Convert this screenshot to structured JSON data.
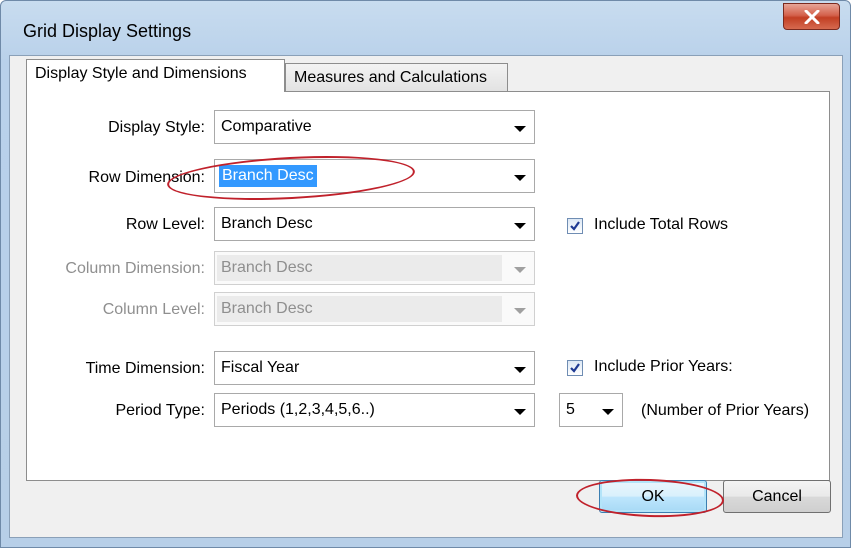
{
  "window": {
    "title": "Grid Display Settings",
    "close_icon": "close-icon"
  },
  "tabs": [
    {
      "label": "Display Style and Dimensions",
      "active": true
    },
    {
      "label": "Measures and Calculations",
      "active": false
    }
  ],
  "form": {
    "display_style": {
      "label": "Display Style:",
      "value": "Comparative"
    },
    "row_dimension": {
      "label": "Row Dimension:",
      "value": "Branch Desc"
    },
    "row_level": {
      "label": "Row Level:",
      "value": "Branch Desc"
    },
    "column_dimension": {
      "label": "Column Dimension:",
      "value": "Branch Desc"
    },
    "column_level": {
      "label": "Column Level:",
      "value": "Branch Desc"
    },
    "time_dimension": {
      "label": "Time Dimension:",
      "value": "Fiscal Year"
    },
    "period_type": {
      "label": "Period Type:",
      "value": "Periods (1,2,3,4,5,6..)"
    },
    "prior_years_count": {
      "value": "5",
      "note": "(Number of Prior Years)"
    }
  },
  "checkboxes": {
    "include_total_rows": {
      "label": "Include Total Rows",
      "checked": true
    },
    "include_prior_years": {
      "label": "Include Prior Years:",
      "checked": true
    }
  },
  "buttons": {
    "ok": "OK",
    "cancel": "Cancel"
  },
  "colors": {
    "highlight": "#3399ff",
    "annotation": "#c0212b"
  }
}
